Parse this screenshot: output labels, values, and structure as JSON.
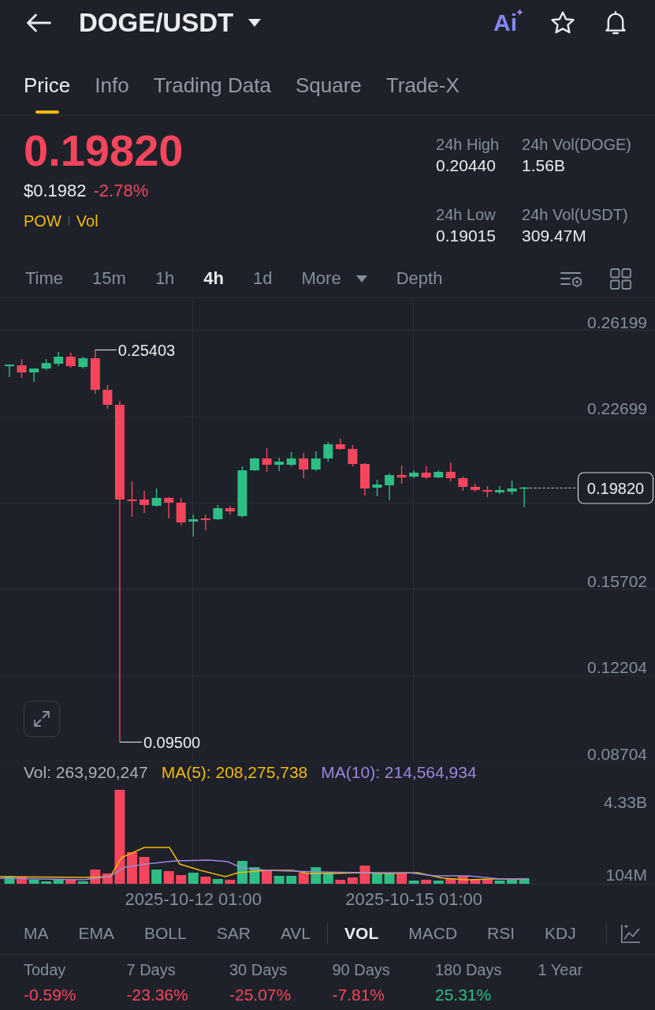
{
  "header": {
    "title": "DOGE/USDT",
    "ai_label": "Ai"
  },
  "tabs": [
    {
      "label": "Price",
      "selected": true
    },
    {
      "label": "Info",
      "selected": false
    },
    {
      "label": "Trading Data",
      "selected": false
    },
    {
      "label": "Square",
      "selected": false
    },
    {
      "label": "Trade-X",
      "selected": false
    }
  ],
  "ticker": {
    "last_price": "0.19820",
    "usd_price": "$0.1982",
    "change": "-2.78%",
    "rising": false,
    "tags": [
      "POW",
      "Vol"
    ]
  },
  "stats": [
    {
      "label": "24h High",
      "value": "0.20440"
    },
    {
      "label": "24h Vol(DOGE)",
      "value": "1.56B"
    },
    {
      "label": "24h Low",
      "value": "0.19015"
    },
    {
      "label": "24h Vol(USDT)",
      "value": "309.47M"
    }
  ],
  "intervals": [
    {
      "label": "Time",
      "kind": "option",
      "selected": false
    },
    {
      "label": "15m",
      "kind": "option",
      "selected": false
    },
    {
      "label": "1h",
      "kind": "option",
      "selected": false
    },
    {
      "label": "4h",
      "kind": "option",
      "selected": true
    },
    {
      "label": "1d",
      "kind": "option",
      "selected": false
    },
    {
      "label": "More",
      "kind": "dropdown",
      "selected": false
    },
    {
      "label": "Depth",
      "kind": "option",
      "selected": false
    }
  ],
  "price_chart": {
    "high_label": "0.25403",
    "low_label": "0.09500",
    "last_price_tag": "0.19820",
    "chart_data": {
      "type": "candlestick",
      "categories": [
        null,
        null,
        null,
        null,
        null,
        null,
        null,
        null,
        null,
        null,
        null,
        null,
        null,
        null,
        null,
        "2025-10-12 01:00",
        null,
        null,
        null,
        null,
        null,
        null,
        null,
        null,
        null,
        null,
        null,
        null,
        null,
        null,
        null,
        null,
        null,
        "2025-10-15 01:00",
        null,
        null,
        null,
        null,
        null,
        null,
        null,
        null,
        null
      ],
      "ohlc": [
        [
          0.24742,
          0.24806,
          0.24294,
          0.24806
        ],
        [
          0.24774,
          0.2503,
          0.24262,
          0.24486
        ],
        [
          0.24486,
          0.24646,
          0.24102,
          0.24646
        ],
        [
          0.24646,
          0.2503,
          0.24582,
          0.2487
        ],
        [
          0.24838,
          0.25318,
          0.24742,
          0.25126
        ],
        [
          0.25126,
          0.25286,
          0.24678,
          0.24742
        ],
        [
          0.2471,
          0.25126,
          0.24646,
          0.25062
        ],
        [
          0.25062,
          0.25403,
          0.23622,
          0.23782
        ],
        [
          0.23782,
          0.23974,
          0.23013,
          0.23173
        ],
        [
          0.23173,
          0.23333,
          0.095,
          0.19332
        ],
        [
          0.19332,
          0.20068,
          0.18628,
          0.19268
        ],
        [
          0.19332,
          0.19684,
          0.18788,
          0.19108
        ],
        [
          0.19076,
          0.1978,
          0.19044,
          0.19396
        ],
        [
          0.19396,
          0.19428,
          0.18564,
          0.19204
        ],
        [
          0.19204,
          0.19396,
          0.18275,
          0.18403
        ],
        [
          0.18435,
          0.18724,
          0.17827,
          0.18531
        ],
        [
          0.18564,
          0.18724,
          0.18083,
          0.18499
        ],
        [
          0.18531,
          0.19108,
          0.18499,
          0.1898
        ],
        [
          0.1898,
          0.19076,
          0.18724,
          0.18852
        ],
        [
          0.1866,
          0.20676,
          0.18596,
          0.20516
        ],
        [
          0.20516,
          0.21029,
          0.20484,
          0.20996
        ],
        [
          0.20996,
          0.21413,
          0.20452,
          0.2074
        ],
        [
          0.2074,
          0.21029,
          0.20484,
          0.20868
        ],
        [
          0.2074,
          0.21253,
          0.20676,
          0.20996
        ],
        [
          0.20996,
          0.21221,
          0.20196,
          0.20548
        ],
        [
          0.20548,
          0.21285,
          0.20484,
          0.20996
        ],
        [
          0.20996,
          0.21669,
          0.20868,
          0.21573
        ],
        [
          0.21573,
          0.21797,
          0.21349,
          0.21381
        ],
        [
          0.21381,
          0.21541,
          0.20676,
          0.20772
        ],
        [
          0.20772,
          0.20804,
          0.19492,
          0.1978
        ],
        [
          0.19812,
          0.20132,
          0.1946,
          0.1994
        ],
        [
          0.19908,
          0.20388,
          0.193,
          0.20324
        ],
        [
          0.20324,
          0.20708,
          0.19972,
          0.20228
        ],
        [
          0.2026,
          0.20516,
          0.20196,
          0.2042
        ],
        [
          0.2042,
          0.20676,
          0.20164,
          0.20228
        ],
        [
          0.20228,
          0.20516,
          0.20196,
          0.20452
        ],
        [
          0.20452,
          0.20836,
          0.20068,
          0.20196
        ],
        [
          0.20196,
          0.2026,
          0.19684,
          0.19844
        ],
        [
          0.19844,
          0.19972,
          0.19652,
          0.19716
        ],
        [
          0.19716,
          0.19876,
          0.19428,
          0.19652
        ],
        [
          0.1962,
          0.19876,
          0.19556,
          0.19716
        ],
        [
          0.19652,
          0.201,
          0.19524,
          0.1978
        ],
        [
          0.1978,
          0.19844,
          0.19015,
          0.1982
        ]
      ],
      "ylim": [
        0.08704,
        0.27528
      ],
      "yticks": [
        {
          "value": 0.26199,
          "label": "0.26199"
        },
        {
          "value": 0.22699,
          "label": "0.22699"
        },
        {
          "value": 0.15702,
          "label": "0.15702"
        },
        {
          "value": 0.12204,
          "label": "0.12204"
        },
        {
          "value": 0.08704,
          "label": "0.08704"
        }
      ],
      "grid": true
    }
  },
  "volume_chart": {
    "readouts": [
      {
        "text": "Vol: 263,920,247",
        "color": "#aab0b9"
      },
      {
        "text": "MA(5): 208,275,738",
        "color": "#f0b90b"
      },
      {
        "text": "MA(10): 214,564,934",
        "color": "#9b86e0"
      }
    ],
    "y_axis_labels": [
      "4.33B",
      "104M"
    ]
  },
  "main_indicators": [
    {
      "label": "MA",
      "selected": false
    },
    {
      "label": "EMA",
      "selected": false
    },
    {
      "label": "BOLL",
      "selected": false
    },
    {
      "label": "SAR",
      "selected": false
    },
    {
      "label": "AVL",
      "selected": false
    }
  ],
  "sub_indicators": [
    {
      "label": "VOL",
      "selected": true
    },
    {
      "label": "MACD",
      "selected": false
    },
    {
      "label": "RSI",
      "selected": false
    },
    {
      "label": "KDJ",
      "selected": false
    }
  ],
  "performance": [
    {
      "period": "Today",
      "change": "-0.59%",
      "rising": false
    },
    {
      "period": "7 Days",
      "change": "-23.36%",
      "rising": false
    },
    {
      "period": "30 Days",
      "change": "-25.07%",
      "rising": false
    },
    {
      "period": "90 Days",
      "change": "-7.81%",
      "rising": false
    },
    {
      "period": "180 Days",
      "change": "25.31%",
      "rising": true
    },
    {
      "period": "1 Year"
    }
  ]
}
